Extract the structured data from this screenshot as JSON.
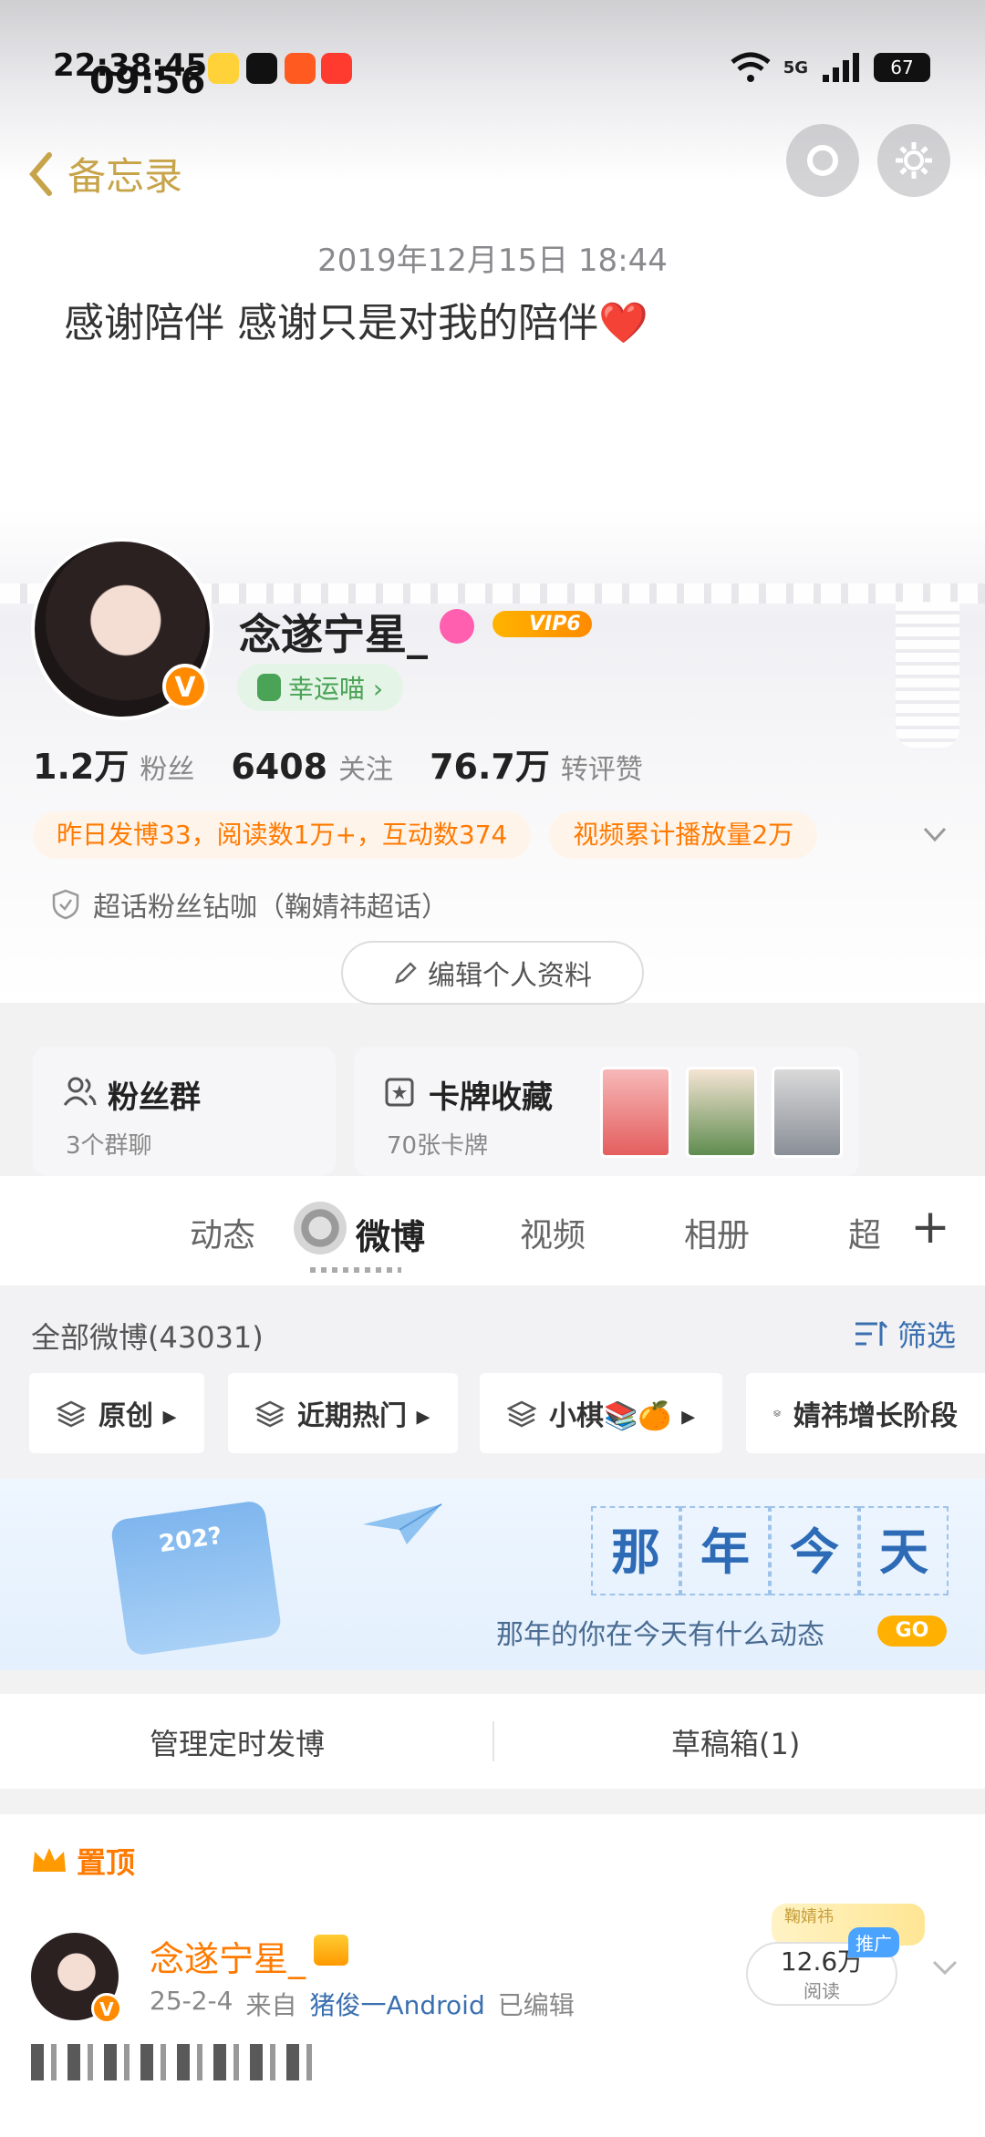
{
  "status": {
    "time_overlay": "22:38:45",
    "time": "09:56",
    "battery": "67",
    "network": "5G"
  },
  "memo": {
    "back_label": "备忘录",
    "date": "2019年12月15日 18:44",
    "text": "感谢陪伴 感谢只是对我的陪伴❤️"
  },
  "profile": {
    "nickname": "念遂宁星_",
    "vip": "VIP6",
    "lucky": "幸运喵 ›",
    "stats": [
      {
        "num": "1.2万",
        "label": "粉丝"
      },
      {
        "num": "6408",
        "label": "关注"
      },
      {
        "num": "76.7万",
        "label": "转评赞"
      }
    ],
    "tags": [
      "昨日发博33，阅读数1万+，互动数374",
      "视频累计播放量2万"
    ],
    "supertalk": "超话粉丝钻咖（鞠婧祎超话）",
    "edit_label": "编辑个人资料"
  },
  "cards": {
    "fans": {
      "title": "粉丝群",
      "sub": "3个群聊"
    },
    "collect": {
      "title": "卡牌收藏",
      "sub": "70张卡牌"
    }
  },
  "tabs": [
    "动态",
    "微博",
    "视频",
    "相册",
    "超"
  ],
  "feed": {
    "all": "全部微博(43031)",
    "filter": "筛选",
    "chips": [
      "原创 ▸",
      "近期热门 ▸",
      "小棋📚🍊 ▸",
      "婧祎增长阶段"
    ]
  },
  "banner": {
    "title_chars": [
      "那",
      "年",
      "今",
      "天"
    ],
    "subtitle": "那年的你在今天有什么动态",
    "go": "GO",
    "year": "202?"
  },
  "manage": {
    "left": "管理定时发博",
    "right": "草稿箱(1)"
  },
  "post": {
    "pinned": "置顶",
    "name": "念遂宁星_",
    "date": "25-2-4",
    "from": "来自",
    "source": "猪俊一Android",
    "edited": "已编辑",
    "reads": "12.6万",
    "reads_label": "阅读",
    "promo": "推广",
    "promo_deco": "鞠婧祎"
  },
  "colors": {
    "accent_orange": "#ff7a00",
    "link_blue": "#3a6fb0",
    "memo_gold": "#c7a44a"
  }
}
